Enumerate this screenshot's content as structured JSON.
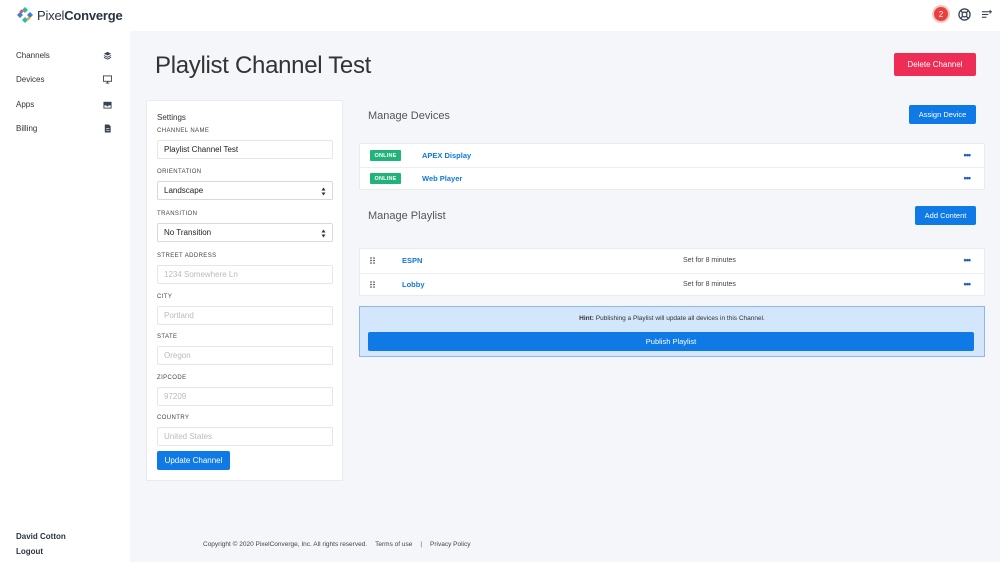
{
  "brand": {
    "name_light": "Pixel",
    "name_bold": "Converge"
  },
  "header": {
    "notification_count": "2",
    "icons": [
      "notification-badge",
      "lifebuoy-icon",
      "menu-add-icon"
    ]
  },
  "sidebar": {
    "items": [
      {
        "label": "Channels",
        "icon": "layers-icon"
      },
      {
        "label": "Devices",
        "icon": "monitor-icon"
      },
      {
        "label": "Apps",
        "icon": "box-icon"
      },
      {
        "label": "Billing",
        "icon": "document-icon"
      }
    ],
    "user_name": "David Cotton",
    "logout_label": "Logout"
  },
  "page": {
    "title": "Playlist Channel Test",
    "delete_label": "Delete Channel"
  },
  "settings": {
    "title": "Settings",
    "channel_name_label": "CHANNEL NAME",
    "channel_name_value": "Playlist Channel Test",
    "orientation_label": "ORIENTATION",
    "orientation_value": "Landscape",
    "transition_label": "TRANSITION",
    "transition_value": "No Transition",
    "street_label": "STREET ADDRESS",
    "street_placeholder": "1234 Somewhere Ln",
    "city_label": "CITY",
    "city_placeholder": "Portland",
    "state_label": "STATE",
    "state_placeholder": "Oregon",
    "zip_label": "ZIPCODE",
    "zip_placeholder": "97209",
    "country_label": "COUNTRY",
    "country_placeholder": "United States",
    "update_label": "Update Channel"
  },
  "devices": {
    "title": "Manage Devices",
    "assign_label": "Assign Device",
    "rows": [
      {
        "status": "ONLINE",
        "name": "APEX Display"
      },
      {
        "status": "ONLINE",
        "name": "Web Player"
      }
    ]
  },
  "playlist": {
    "title": "Manage Playlist",
    "add_label": "Add Content",
    "rows": [
      {
        "name": "ESPN",
        "duration": "Set for 8 minutes"
      },
      {
        "name": "Lobby",
        "duration": "Set for 8 minutes"
      }
    ]
  },
  "hint": {
    "prefix": "Hint:",
    "text": " Publishing a Playlist will update all devices in this Channel.",
    "publish_label": "Publish Playlist"
  },
  "footer": {
    "copyright": "Copyright © 2020 PixelConverge, Inc. All rights reserved.",
    "terms": "Terms of use",
    "separator": "|",
    "privacy": "Privacy Policy"
  },
  "colors": {
    "primary": "#0f7ae5",
    "danger": "#ee2d56",
    "online": "#21b37a",
    "link": "#1178d8"
  }
}
